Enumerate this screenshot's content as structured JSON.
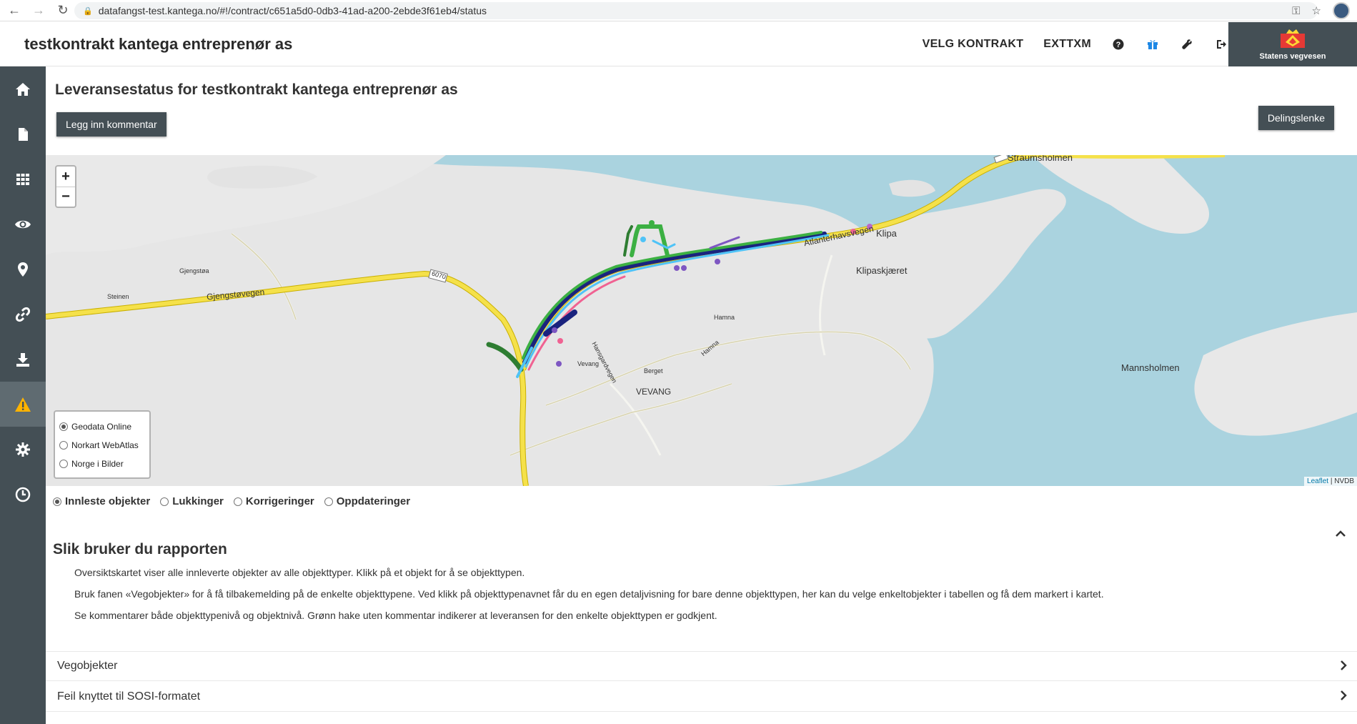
{
  "browser": {
    "url": "datafangst-test.kantega.no/#!/contract/c651a5d0-0db3-41ad-a200-2ebde3f61eb4/status"
  },
  "header": {
    "title": "testkontrakt kantega entreprenør as",
    "nav_contract": "VELG KONTRAKT",
    "nav_user": "EXTTXM",
    "logo_text": "Statens vegvesen"
  },
  "sidebar": {
    "items": [
      {
        "icon": "home-icon"
      },
      {
        "icon": "document-icon"
      },
      {
        "icon": "grid-icon"
      },
      {
        "icon": "eye-icon"
      },
      {
        "icon": "map-marker-icon"
      },
      {
        "icon": "link-icon"
      },
      {
        "icon": "download-icon"
      },
      {
        "icon": "warning-icon",
        "active": true
      },
      {
        "icon": "gear-icon"
      },
      {
        "icon": "clock-icon"
      }
    ]
  },
  "main": {
    "heading": "Leveransestatus for testkontrakt kantega entreprenør as",
    "comment_button": "Legg inn kommentar",
    "share_button": "Delingslenke"
  },
  "map": {
    "zoom_in": "+",
    "zoom_out": "−",
    "layers": [
      {
        "label": "Geodata Online",
        "checked": true
      },
      {
        "label": "Norkart WebAtlas",
        "checked": false
      },
      {
        "label": "Norge i Bilder",
        "checked": false
      }
    ],
    "attribution_leaflet": "Leaflet",
    "attribution_rest": " | NVDB",
    "labels": {
      "straumsholmen": "Straumsholmen",
      "klipa": "Klipa",
      "klipaskjaeret": "Klipaskjæret",
      "mannsholmen": "Mannsholmen",
      "gjengstoa": "Gjengstøa",
      "steinen": "Steinen",
      "gjengstovegen": "Gjengstøvegen",
      "road_6070": "6070",
      "hamna_place": "Hamna",
      "hamna_road": "Hamna",
      "hansgardvegen": "Hansgardvegen",
      "vevang_small": "Vevang",
      "berget": "Berget",
      "vevang": "VEVANG",
      "atlanterhavsvegen": "Atlanterhavsvegen"
    },
    "colors": {
      "water": "#aad3df",
      "land": "#e8e8e8",
      "main_road": "#f5e14a",
      "green": "#3cb043",
      "dark_green": "#2e7d32",
      "navy": "#1a237e",
      "cyan": "#4fc3f7",
      "pink": "#f06292",
      "purple": "#7e57c2"
    }
  },
  "filters": [
    {
      "label": "Innleste objekter",
      "checked": true
    },
    {
      "label": "Lukkinger",
      "checked": false
    },
    {
      "label": "Korrigeringer",
      "checked": false
    },
    {
      "label": "Oppdateringer",
      "checked": false
    }
  ],
  "report": {
    "title": "Slik bruker du rapporten",
    "help1": "Oversiktskartet viser alle innleverte objekter av alle objekttyper. Klikk på et objekt for å se objekttypen.",
    "help2": "Bruk fanen «Vegobjekter» for å få tilbakemelding på de enkelte objekttypene. Ved klikk på objekttypenavnet får du en egen detaljvisning for bare denne objekttypen, her kan du velge enkeltobjekter i tabellen og få dem markert i kartet.",
    "help3": "Se kommentarer både objekttypenivå og objektnivå. Grønn hake uten kommentar indikerer at leveransen for den enkelte objekttypen er godkjent."
  },
  "accordions": [
    {
      "label": "Vegobjekter"
    },
    {
      "label": "Feil knyttet til SOSI-formatet"
    }
  ]
}
